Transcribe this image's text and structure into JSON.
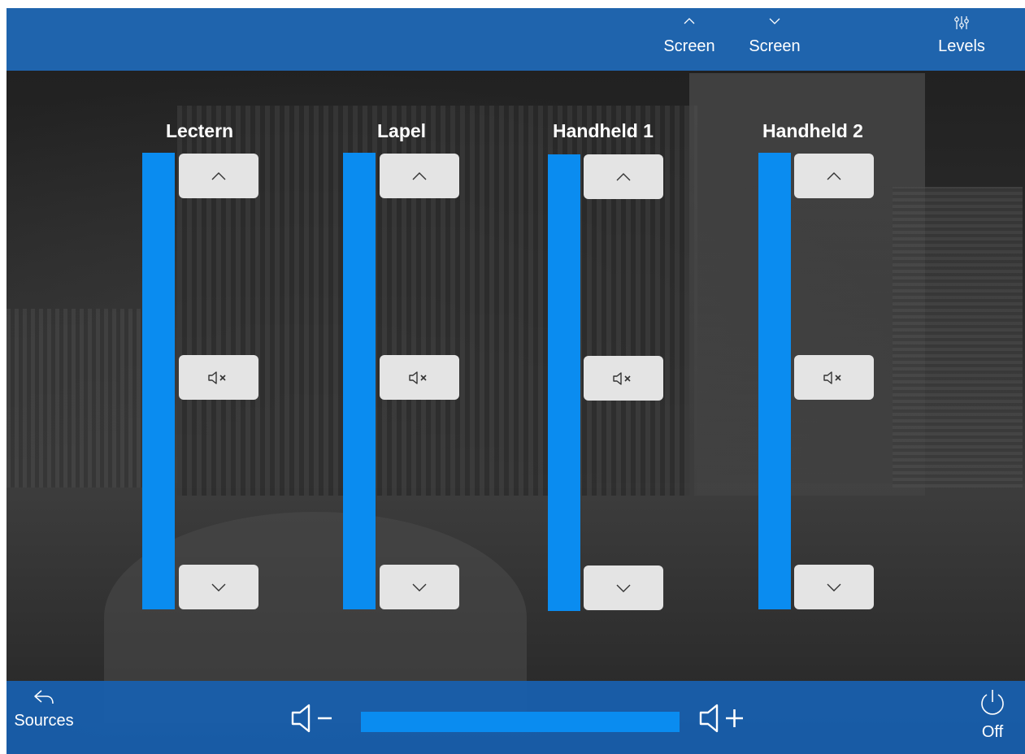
{
  "top_bar": {
    "screen_up": {
      "label": "Screen",
      "icon": "chevron-up-icon"
    },
    "screen_down": {
      "label": "Screen",
      "icon": "chevron-down-icon"
    },
    "levels": {
      "label": "Levels",
      "icon": "levels-sliders-icon"
    }
  },
  "channels": [
    {
      "name": "Lectern",
      "level": 1.0
    },
    {
      "name": "Lapel",
      "level": 1.0
    },
    {
      "name": "Handheld 1",
      "level": 1.0
    },
    {
      "name": "Handheld 2",
      "level": 1.0
    }
  ],
  "channel_icons": {
    "up": "chevron-up-icon",
    "mute": "speaker-mute-icon",
    "down": "chevron-down-icon"
  },
  "bottom_bar": {
    "sources": {
      "label": "Sources",
      "icon": "back-arrow-icon"
    },
    "off": {
      "label": "Off",
      "icon": "power-icon"
    },
    "volume_down_icon": "speaker-minus-icon",
    "volume_up_icon": "speaker-plus-icon",
    "master_level": 1.0
  },
  "colors": {
    "bar_blue": "#1f64ad",
    "meter_blue": "#0a8cf0",
    "button_gray": "#e4e4e4"
  }
}
